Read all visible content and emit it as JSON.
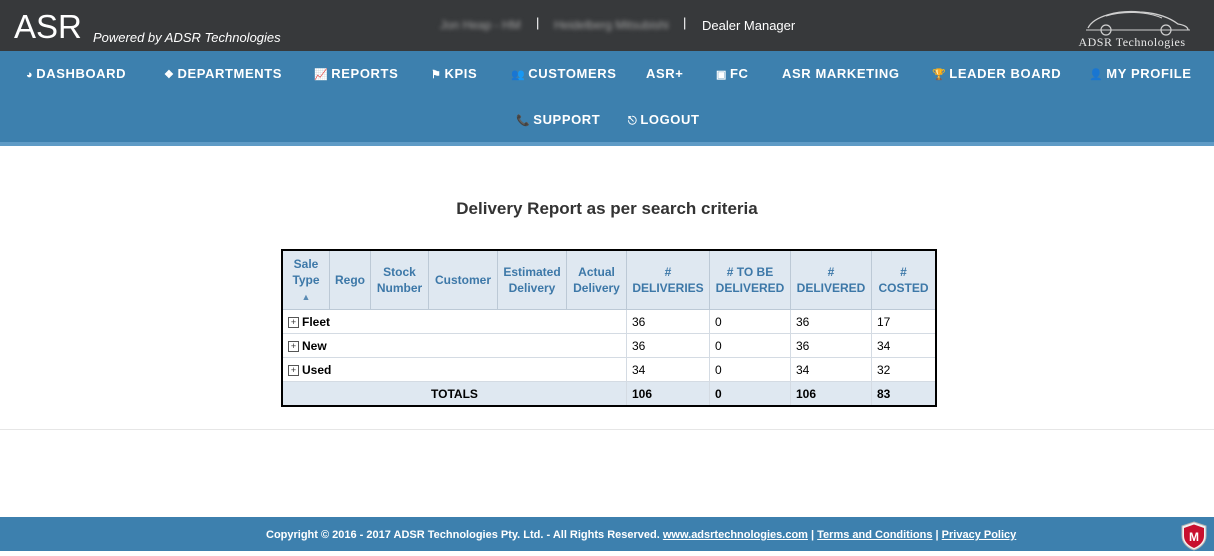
{
  "header": {
    "brand": "ASR",
    "tagline": "Powered by ADSR Technologies",
    "user_name": "Jon Heap - HM",
    "dealership": "Heidelberg Mitsubishi",
    "separator": "|",
    "role": "Dealer Manager",
    "logo_text": "ADSR Technologies"
  },
  "nav": {
    "items": [
      {
        "label": "DASHBOARD",
        "icon": "dashboard-icon",
        "glyph": "◕"
      },
      {
        "label": "DEPARTMENTS",
        "icon": "cubes-icon",
        "glyph": "❖"
      },
      {
        "label": "REPORTS",
        "icon": "line-chart-icon",
        "glyph": "📈"
      },
      {
        "label": "KPIS",
        "icon": "flag-icon",
        "glyph": "⚑"
      },
      {
        "label": "CUSTOMERS",
        "icon": "users-icon",
        "glyph": "👥"
      },
      {
        "label": "ASR+",
        "icon": "",
        "glyph": ""
      },
      {
        "label": "FC",
        "icon": "money-icon",
        "glyph": "▣"
      },
      {
        "label": "ASR MARKETING",
        "icon": "",
        "glyph": ""
      },
      {
        "label": "LEADER BOARD",
        "icon": "trophy-icon",
        "glyph": "🏆"
      },
      {
        "label": "MY PROFILE",
        "icon": "user-icon",
        "glyph": "👤"
      },
      {
        "label": "SUPPORT",
        "icon": "phone-icon",
        "glyph": "📞"
      },
      {
        "label": "LOGOUT",
        "icon": "sign-out-icon",
        "glyph": "⎋"
      }
    ]
  },
  "report": {
    "title": "Delivery Report as per search criteria",
    "headers": {
      "sale_type_1": "Sale",
      "sale_type_2": "Type",
      "sort_indicator": "▲",
      "rego": "Rego",
      "stock_1": "Stock",
      "stock_2": "Number",
      "customer": "Customer",
      "est_1": "Estimated",
      "est_2": "Delivery",
      "act_1": "Actual",
      "act_2": "Delivery",
      "deliveries_1": "#",
      "deliveries_2": "DELIVERIES",
      "to_be_1": "# TO BE",
      "to_be_2": "DELIVERED",
      "delivered_1": "#",
      "delivered_2": "DELIVERED",
      "costed_1": "#",
      "costed_2": "COSTED"
    },
    "rows": [
      {
        "label": "Fleet",
        "deliveries": "36",
        "to_be": "0",
        "delivered": "36",
        "costed": "17"
      },
      {
        "label": "New",
        "deliveries": "36",
        "to_be": "0",
        "delivered": "36",
        "costed": "34"
      },
      {
        "label": "Used",
        "deliveries": "34",
        "to_be": "0",
        "delivered": "34",
        "costed": "32"
      }
    ],
    "expand_glyph": "+",
    "totals": {
      "label": "TOTALS",
      "deliveries": "106",
      "to_be": "0",
      "delivered": "106",
      "costed": "83"
    }
  },
  "footer": {
    "copyright": "Copyright © 2016 - 2017 ADSR Technologies Pty. Ltd. - All Rights Reserved.",
    "website": "www.adsrtechnologies.com",
    "sep": "|",
    "terms": "Terms and Conditions",
    "privacy": "Privacy Policy",
    "badge_letter": "M"
  }
}
